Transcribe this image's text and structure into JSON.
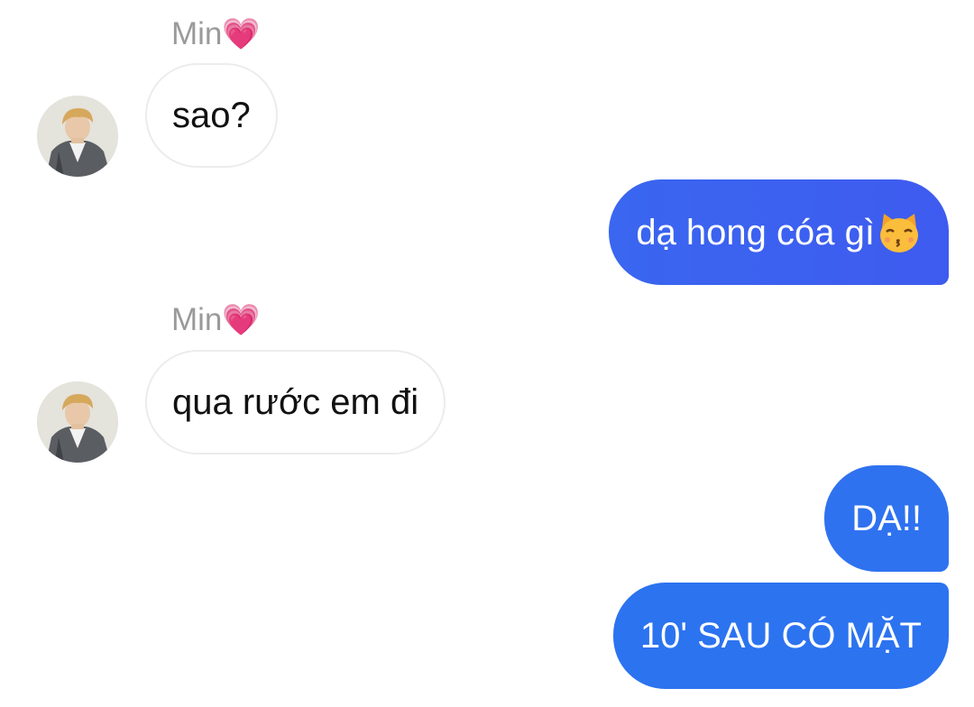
{
  "conversation": {
    "messages": [
      {
        "direction": "incoming",
        "sender_name": "Min",
        "sender_emoji": "💗",
        "text": "sao?"
      },
      {
        "direction": "outgoing",
        "text": "dạ hong cóa gì",
        "emoji": "kissing-cat-face"
      },
      {
        "direction": "incoming",
        "sender_name": "Min",
        "sender_emoji": "💗",
        "text": "qua rước em đi"
      },
      {
        "direction": "outgoing",
        "text": "DẠ!!"
      },
      {
        "direction": "outgoing",
        "text": "10' SAU CÓ MẶT"
      }
    ]
  },
  "colors": {
    "outgoing_bubble": "#3a66f0",
    "outgoing_text": "#ffffff",
    "incoming_bubble": "#ffffff",
    "incoming_border": "#ececec",
    "sender_name": "#9a9a9a"
  },
  "icons": {
    "avatar": "contact-avatar-photo",
    "heart": "growing-heart-emoji",
    "cat": "kissing-cat-emoji"
  }
}
